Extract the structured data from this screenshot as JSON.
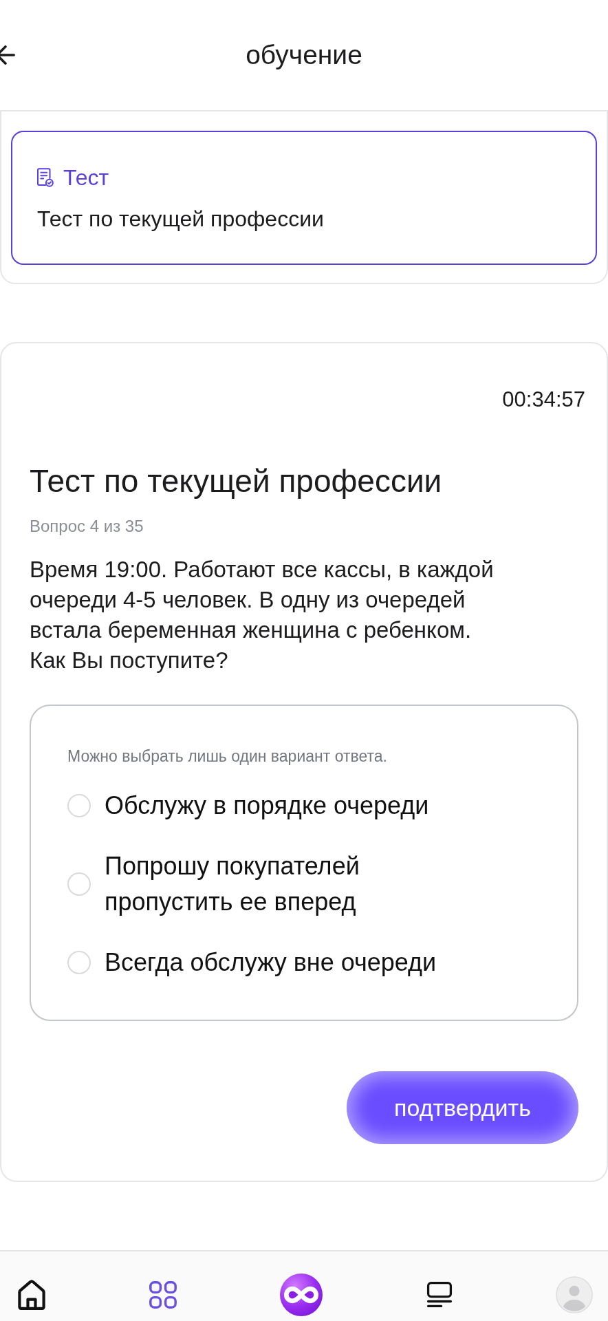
{
  "header": {
    "title": "обучение"
  },
  "test_card": {
    "type_label": "Тест",
    "title": "Тест по текущей профессии"
  },
  "quiz": {
    "timer": "00:34:57",
    "title": "Тест по текущей профессии",
    "progress": "Вопрос 4 из 35",
    "question": "Время 19:00. Работают все кассы, в каждой очереди 4-5 человек. В одну из очередей встала беременная женщина с ребенком. Как Вы поступите?",
    "hint": "Можно выбрать лишь один вариант ответа.",
    "options": [
      {
        "label": "Обслужу в порядке очереди",
        "selected": false
      },
      {
        "label": "Попрошу покупателей пропустить ее вперед",
        "selected": false
      },
      {
        "label": "Всегда обслужу вне очереди",
        "selected": false
      }
    ],
    "submit": "подтвердить"
  },
  "nav": {
    "items": [
      {
        "kind": "home",
        "selected": false
      },
      {
        "kind": "grid",
        "selected": true
      },
      {
        "kind": "brand",
        "selected": false
      },
      {
        "kind": "list",
        "selected": false
      },
      {
        "kind": "profile",
        "selected": false
      }
    ]
  }
}
